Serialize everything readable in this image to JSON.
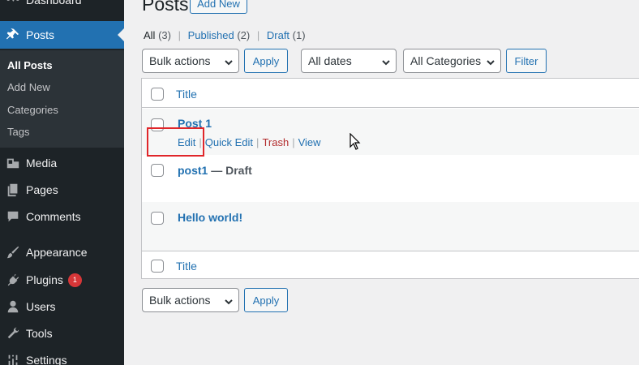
{
  "sidebar": {
    "dashboard": "Dashboard",
    "posts": "Posts",
    "submenu": [
      "All Posts",
      "Add New",
      "Categories",
      "Tags"
    ],
    "media": "Media",
    "pages": "Pages",
    "comments": "Comments",
    "appearance": "Appearance",
    "plugins": "Plugins",
    "plugins_badge": "1",
    "users": "Users",
    "tools": "Tools",
    "settings": "Settings"
  },
  "page": {
    "title": "Posts",
    "add_new": "Add New"
  },
  "filters": {
    "all": "All",
    "all_count": "(3)",
    "published": "Published",
    "published_count": "(2)",
    "draft": "Draft",
    "draft_count": "(1)",
    "sep": "|"
  },
  "toolbar": {
    "bulk_actions": "Bulk actions",
    "apply": "Apply",
    "all_dates": "All dates",
    "all_categories": "All Categories",
    "filter": "Filter"
  },
  "table": {
    "title_header": "Title",
    "rows": [
      {
        "title": "Post 1",
        "state": ""
      },
      {
        "title": "post1",
        "state": "— Draft"
      },
      {
        "title": "Hello world!",
        "state": ""
      }
    ],
    "row_actions": {
      "edit": "Edit",
      "quick_edit": "Quick Edit",
      "trash": "Trash",
      "view": "View",
      "sep": "|"
    }
  },
  "colors": {
    "sidebar_bg": "#1d2327",
    "accent": "#2271b1",
    "trash": "#b32d2e",
    "highlight": "#e0262a"
  }
}
